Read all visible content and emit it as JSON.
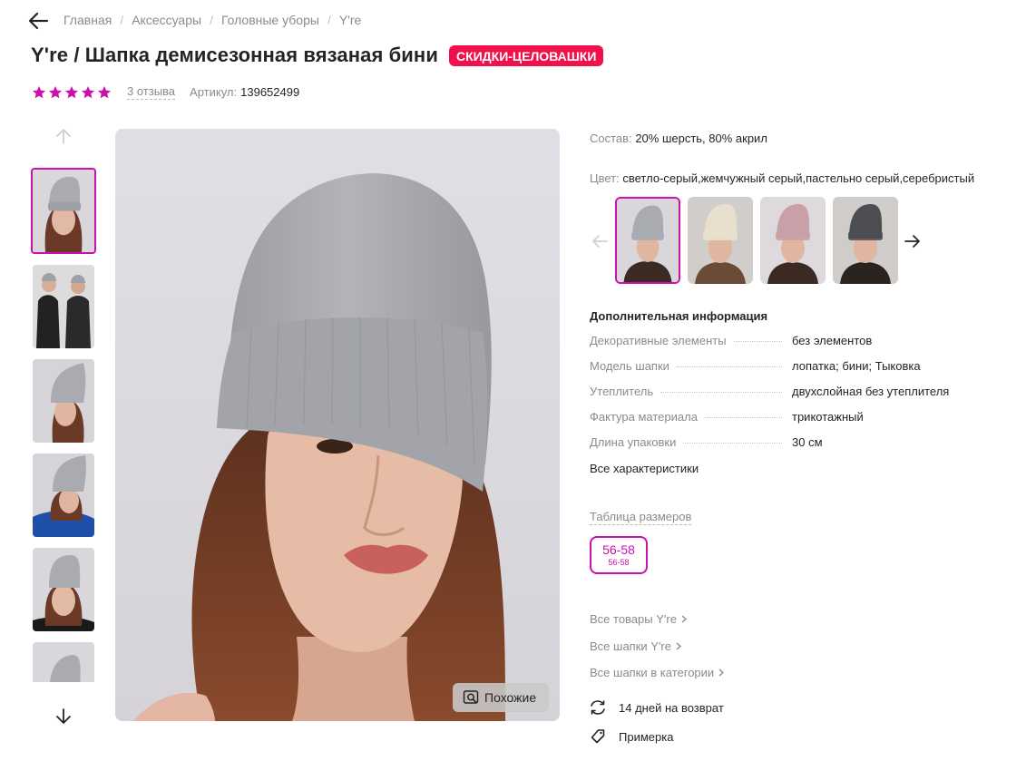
{
  "breadcrumbs": [
    "Главная",
    "Аксессуары",
    "Головные уборы",
    "Y're"
  ],
  "product": {
    "title": "Y're / Шапка демисезонная вязаная бини",
    "badge": "Скидки-Целовашки",
    "rating_stars": 5,
    "reviews": "3 отзыва",
    "article_label": "Артикул:",
    "article": "139652499"
  },
  "composition": {
    "label": "Состав:",
    "value": "20% шерсть, 80% акрил"
  },
  "color": {
    "label": "Цвет:",
    "value": "светло-серый,жемчужный серый,пастельно серый,серебристый"
  },
  "color_variants": [
    {
      "name": "light-grey",
      "hat": "#a9abb0",
      "bg": "#d9d7dc",
      "active": true
    },
    {
      "name": "cream",
      "hat": "#e8e0cc",
      "bg": "#d0cdca",
      "active": false
    },
    {
      "name": "pink",
      "hat": "#caa0a8",
      "bg": "#ded9dc",
      "active": false
    },
    {
      "name": "dark-grey",
      "hat": "#4c4e52",
      "bg": "#cfccca",
      "active": false
    }
  ],
  "additional": {
    "title": "Дополнительная информация",
    "rows": [
      {
        "key": "Декоративные элементы",
        "value": "без элементов"
      },
      {
        "key": "Модель шапки",
        "value": "лопатка; бини; Тыковка"
      },
      {
        "key": "Утеплитель",
        "value": "двухслойная без утеплителя"
      },
      {
        "key": "Фактура материала",
        "value": "трикотажный"
      },
      {
        "key": "Длина упаковки",
        "value": "30 см"
      }
    ],
    "all_specs": "Все характеристики"
  },
  "sizes": {
    "table_link": "Таблица размеров",
    "selected": {
      "size": "56-58",
      "ru": "56-58"
    }
  },
  "links": [
    "Все товары Y're",
    "Все шапки Y're",
    "Все шапки в категории"
  ],
  "features": [
    "14 дней на возврат",
    "Примерка"
  ],
  "similar_button": "Похожие",
  "colors": {
    "accent": "#cb11ab",
    "badge": "#f0114c",
    "muted": "#8b8b8b",
    "text": "#242424"
  }
}
